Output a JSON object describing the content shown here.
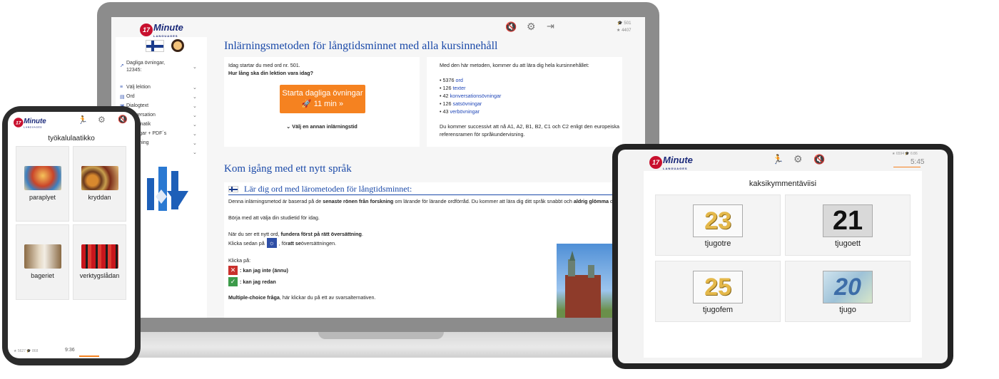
{
  "brand": {
    "logo_number": "17",
    "logo_word": "Minute",
    "logo_sub": "LANGUAGES"
  },
  "laptop": {
    "stats": {
      "words_done": "501",
      "stars": "4407"
    },
    "sidebar": {
      "daily_label": "Dagliga övningar,",
      "daily_count": "12345:",
      "items": [
        {
          "label": "Välj lektion",
          "icon": "list-icon"
        },
        {
          "label": "Ord",
          "icon": "book-icon"
        },
        {
          "label": "Dialogtext",
          "icon": "dialog-icon"
        },
        {
          "label": "Konversation",
          "icon": "chat-icon"
        },
        {
          "label": "Grammatik",
          "icon": "grammar-icon"
        },
        {
          "label": "Övningar + PDF´s",
          "icon": "pdf-icon"
        },
        {
          "label": "Inställning",
          "icon": "settings-icon"
        },
        {
          "label": "",
          "icon": "more-icon"
        }
      ]
    },
    "main": {
      "title": "Inlärningsmetoden för långtidsminnet med alla kursinnehåll",
      "start_text": "Idag startar du med ord nr. 501.",
      "question": "Hur lång ska din lektion vara idag?",
      "start_button": "Starta dagliga övningar",
      "start_minutes": "11 min",
      "start_arrow": "»",
      "other_method": "Välj en annan inlärningstid",
      "method_intro": "Med den här metoden, kommer du att lära dig hela kursinnehållet:",
      "content_list": [
        {
          "count": "5376",
          "label": "ord"
        },
        {
          "count": "126",
          "label": "texter"
        },
        {
          "count": "42",
          "label": "konversationsövningar"
        },
        {
          "count": "126",
          "label": "satsövningar"
        },
        {
          "count": "43",
          "label": "verbövningar"
        }
      ],
      "progress_text": "Du kommer successivt att nå A1, A2, B1, B2, C1 och C2 enligt den europeiska referensramen för språkundervisning.",
      "section_title": "Kom igång med ett nytt språk",
      "subsection_title": "Lär dig ord med lärometoden för långtidsminnet:",
      "para1_a": "Denna inlärningsmetod är baserad på de ",
      "para1_b": "senaste rönen från forskning",
      "para1_c": " om lärande för lärande ordförråd. Du kommer att lära dig ditt språk snabbt och ",
      "para1_d": "aldrig",
      "para1_e": "glömma",
      "para1_f": " det.",
      "para2": "Börja med att välja din studietid för idag.",
      "para3_a": "När du ser ett nytt ord, ",
      "para3_b": "fundera först på rätt översättning",
      "para3_c": ".",
      "para4_a": "Klicka sedan på",
      "para4_b": ", för ",
      "para4_c": "att se",
      "para4_d": " översättningen.",
      "click_on": "Klicka på:",
      "no_label": ": kan jag inte (ännu)",
      "yes_label": ": kan jag redan",
      "mc_a": "Multiple-choice fråga",
      "mc_b": ", här klickar du på ett av svarsalternativen."
    }
  },
  "phone": {
    "title": "työkalulaatikko",
    "tiles": [
      {
        "label": "paraplyet"
      },
      {
        "label": "kryddan"
      },
      {
        "label": "bageriet"
      },
      {
        "label": "verktygslådan"
      }
    ],
    "footer": {
      "stars": "5627",
      "words": "868",
      "time": "9:36"
    }
  },
  "tablet": {
    "stats": {
      "stars": "6594",
      "words": "6:86"
    },
    "time": "5:45",
    "title": "kaksikymmentäviisi",
    "tiles": [
      {
        "number": "23",
        "label": "tjugotre"
      },
      {
        "number": "21",
        "label": "tjugoett"
      },
      {
        "number": "25",
        "label": "tjugofem"
      },
      {
        "number": "20",
        "label": "tjugo"
      }
    ]
  }
}
